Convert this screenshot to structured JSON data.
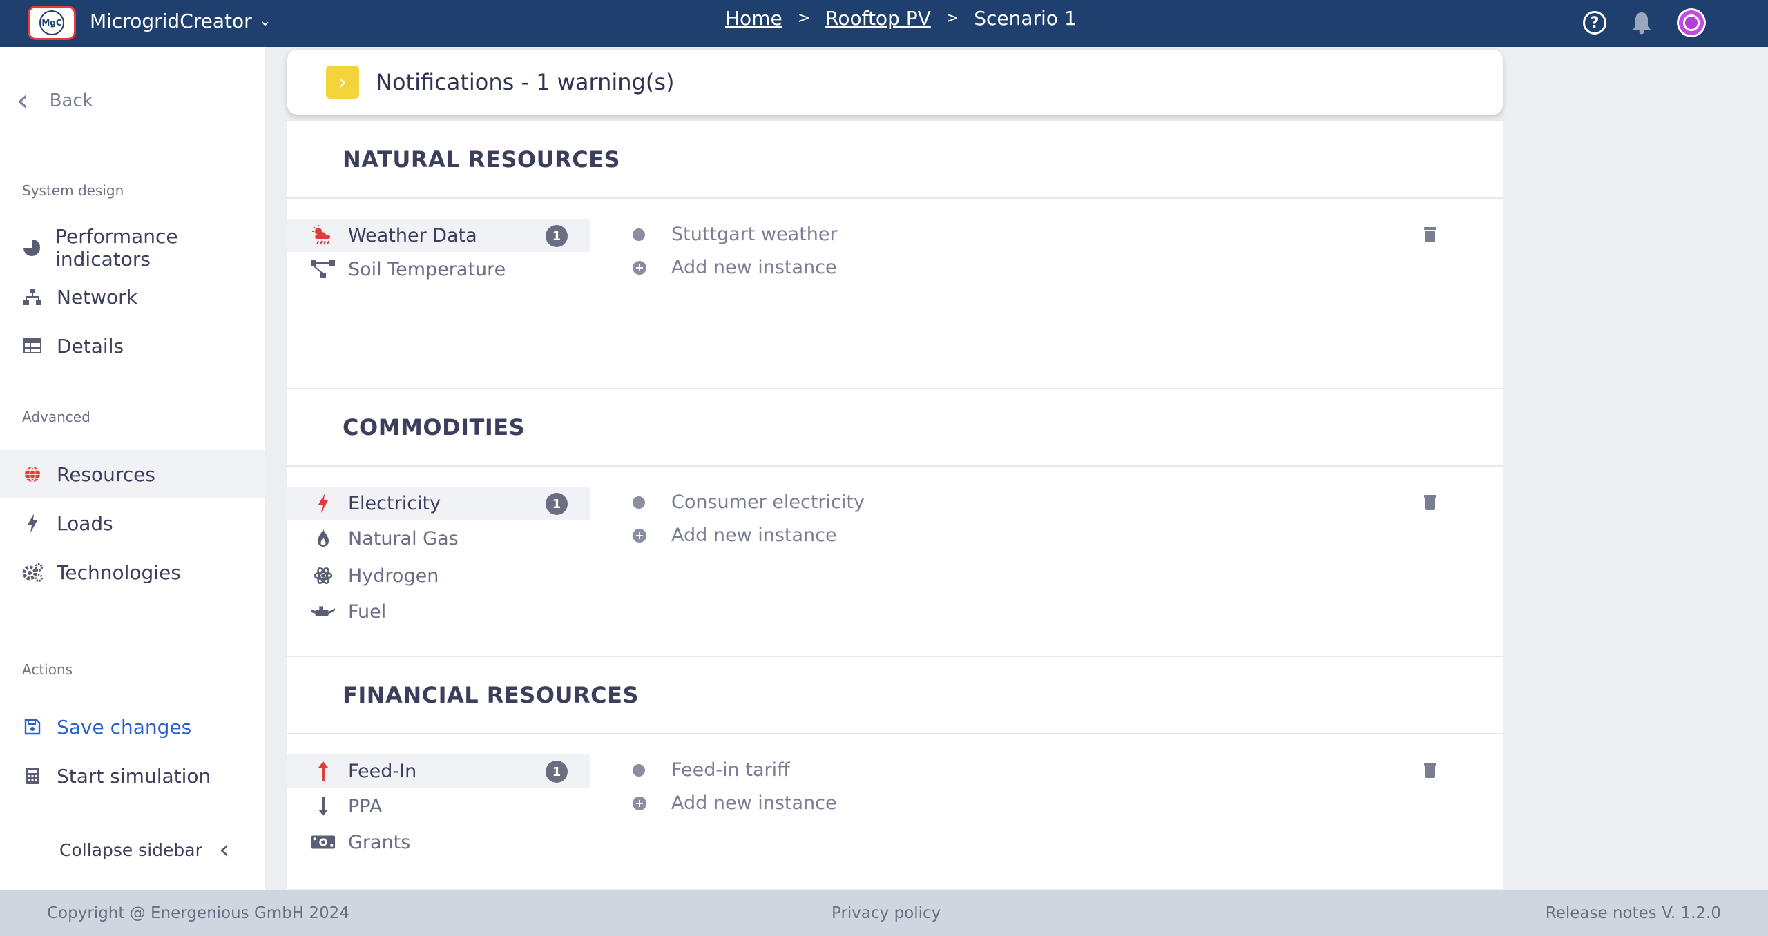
{
  "header": {
    "logo_text": "MgC",
    "app_name": "MicrogridCreator",
    "breadcrumb": [
      "Home",
      "Rooftop PV",
      "Scenario 1"
    ],
    "breadcrumb_sep": ">",
    "help_symbol": "?"
  },
  "sidebar": {
    "back_label": "Back",
    "sections": {
      "system_design": "System design",
      "advanced": "Advanced",
      "actions": "Actions"
    },
    "items": {
      "performance": "Performance indicators",
      "network": "Network",
      "details": "Details",
      "resources": "Resources",
      "loads": "Loads",
      "technologies": "Technologies",
      "save": "Save changes",
      "simulate": "Start simulation"
    },
    "collapse_label": "Collapse sidebar"
  },
  "notifications": {
    "label": "Notifications - 1 warning(s)"
  },
  "panels": {
    "natural": {
      "title": "NATURAL RESOURCES",
      "items": [
        "Weather Data",
        "Soil Temperature"
      ],
      "badge": "1",
      "instance": "Stuttgart weather",
      "add_label": "Add new instance"
    },
    "commodities": {
      "title": "COMMODITIES",
      "items": [
        "Electricity",
        "Natural Gas",
        "Hydrogen",
        "Fuel"
      ],
      "badge": "1",
      "instance": "Consumer electricity",
      "add_label": "Add new instance"
    },
    "financial": {
      "title": "FINANCIAL RESOURCES",
      "items": [
        "Feed-In",
        "PPA",
        "Grants"
      ],
      "badge": "1",
      "instance": "Feed-in tariff",
      "add_label": "Add new instance"
    }
  },
  "footer": {
    "copyright": "Copyright @ Energenious GmbH 2024",
    "privacy": "Privacy policy",
    "release": "Release notes V. 1.2.0"
  },
  "colors": {
    "topbar": "#1f3f6e",
    "accent_red": "#e23b3b",
    "warning_yellow": "#f5d33b",
    "link_blue": "#2962c8"
  }
}
